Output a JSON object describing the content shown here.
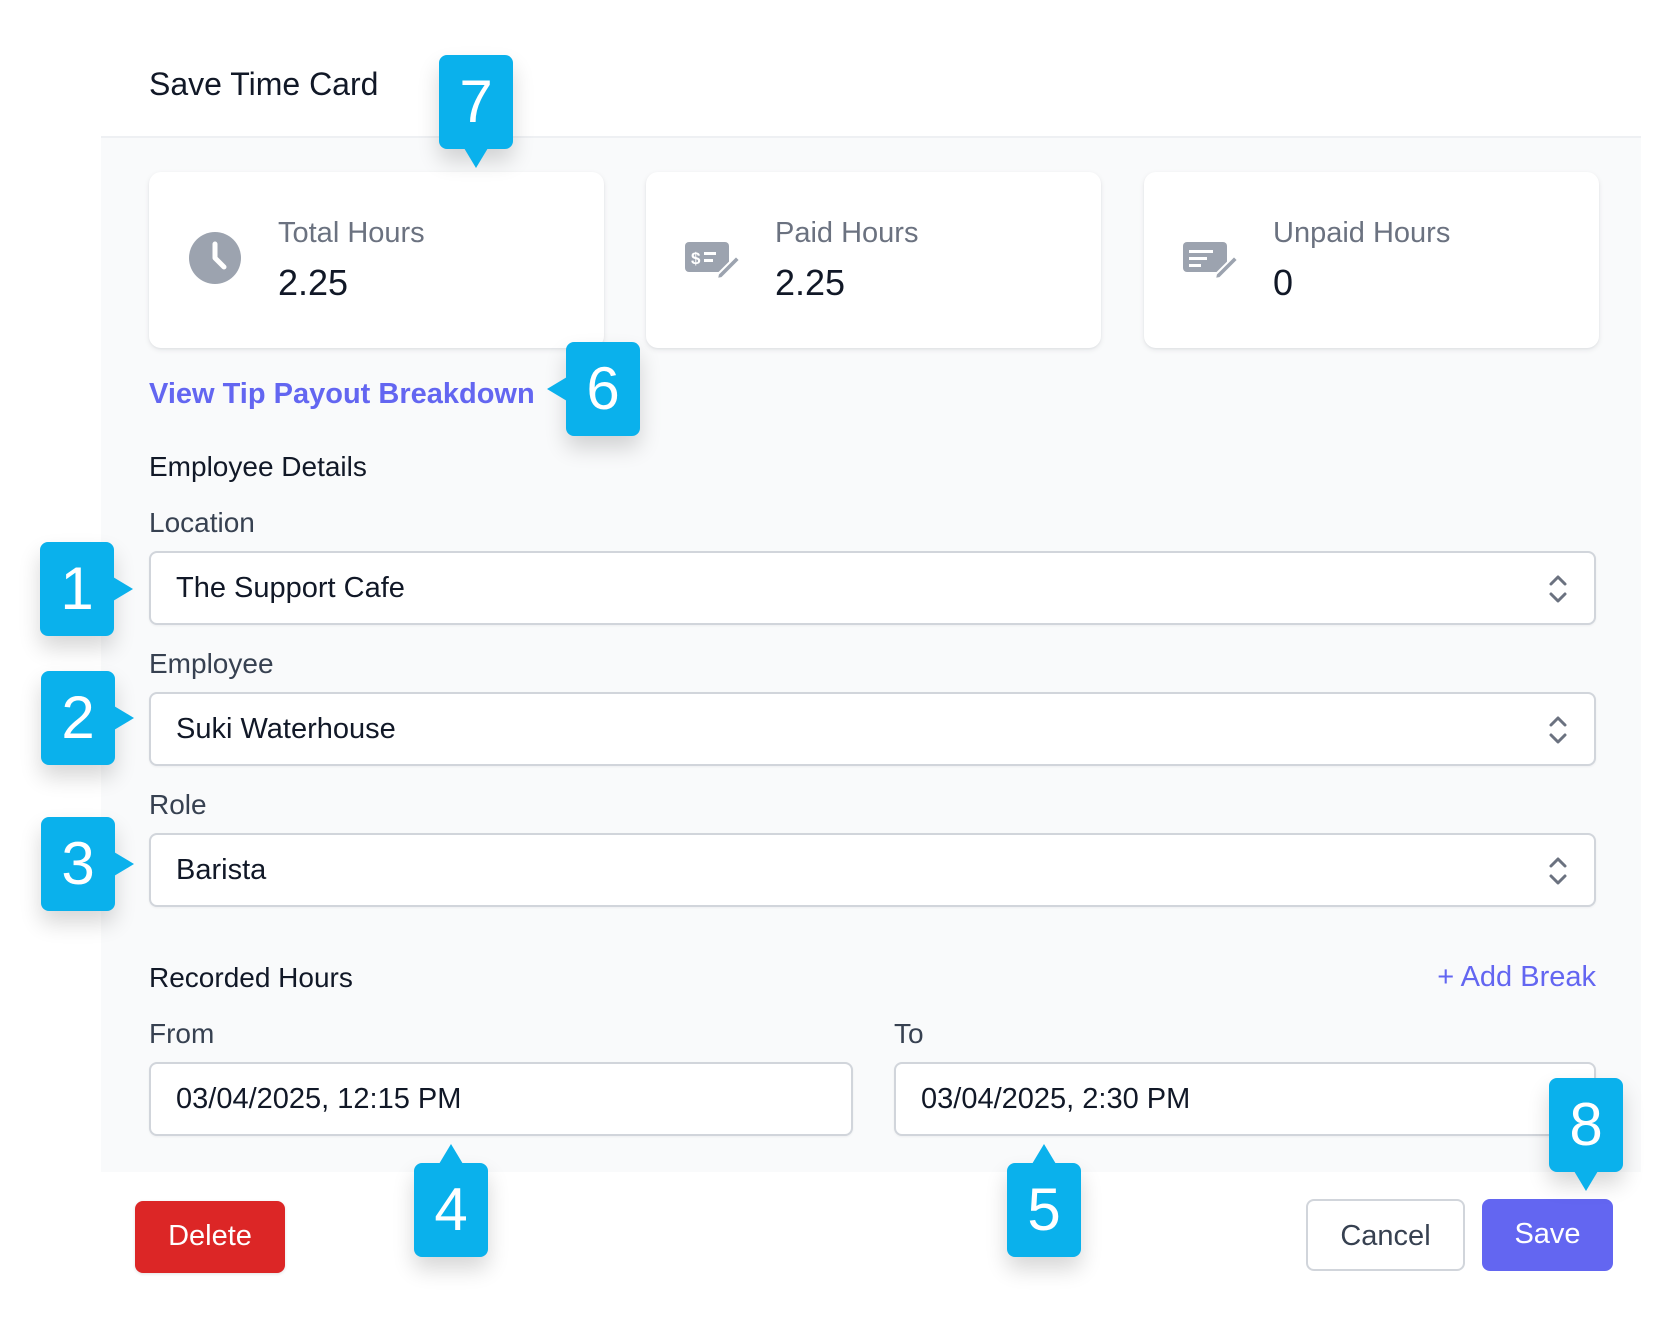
{
  "modal": {
    "title": "Save Time Card"
  },
  "stats": [
    {
      "label": "Total Hours",
      "value": "2.25",
      "icon": "clock-icon"
    },
    {
      "label": "Paid Hours",
      "value": "2.25",
      "icon": "paid-ticket-icon"
    },
    {
      "label": "Unpaid Hours",
      "value": "0",
      "icon": "unpaid-ticket-icon"
    }
  ],
  "tip_link": "View Tip Payout Breakdown",
  "employee_details": {
    "title": "Employee Details",
    "location": {
      "label": "Location",
      "value": "The Support Cafe"
    },
    "employee": {
      "label": "Employee",
      "value": "Suki Waterhouse"
    },
    "role": {
      "label": "Role",
      "value": "Barista"
    }
  },
  "recorded_hours": {
    "title": "Recorded Hours",
    "add_break": "+ Add Break",
    "from": {
      "label": "From",
      "value": "03/04/2025, 12:15 PM"
    },
    "to": {
      "label": "To",
      "value": "03/04/2025, 2:30 PM"
    }
  },
  "footer": {
    "delete_label": "Delete",
    "cancel_label": "Cancel",
    "save_label": "Save"
  },
  "callouts": [
    "1",
    "2",
    "3",
    "4",
    "5",
    "6",
    "7",
    "8"
  ],
  "colors": {
    "accent": "#6366f1",
    "danger": "#dc2626",
    "callout": "#0ab1ec",
    "body_bg": "#f9fafb",
    "icon_gray": "#9ca3af"
  }
}
